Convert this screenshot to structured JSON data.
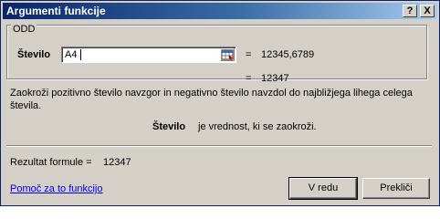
{
  "window": {
    "title": "Argumenti funkcije",
    "help_button": "?",
    "close_button": "X"
  },
  "function": {
    "name": "ODD",
    "argument_label": "Število",
    "argument_value": "A4",
    "argument_equals": "=",
    "argument_result": "12345,6789",
    "result_equals": "=",
    "result_value": "12347"
  },
  "description": "Zaokroži pozitivno število navzgor in negativno število navzdol do najbližjega lihega celega števila.",
  "parameter": {
    "name": "Število",
    "description": "je vrednost, ki se zaokroži."
  },
  "formula_result": {
    "label": "Rezultat formule =",
    "value": "12347"
  },
  "help_link": "Pomoč za to funkcijo",
  "buttons": {
    "ok": "V redu",
    "cancel": "Prekliči"
  }
}
